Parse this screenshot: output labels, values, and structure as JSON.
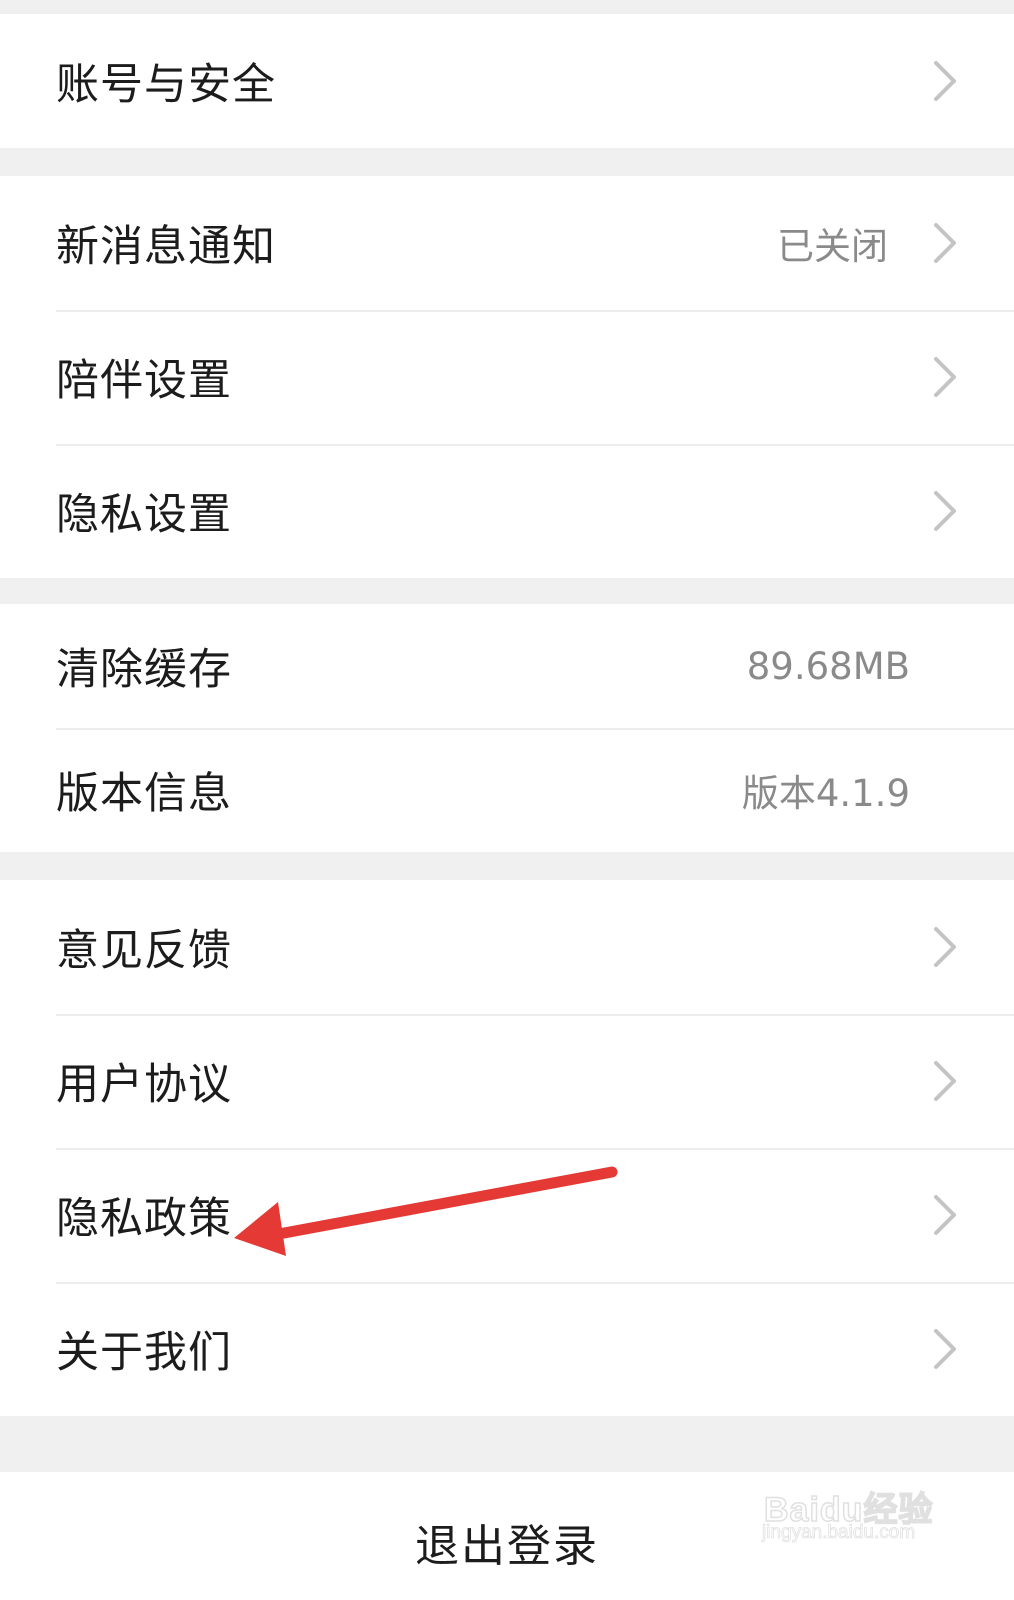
{
  "settings": {
    "groups": [
      {
        "items": [
          {
            "label": "账号与安全",
            "value": "",
            "chevron": true
          }
        ]
      },
      {
        "items": [
          {
            "label": "新消息通知",
            "value": "已关闭",
            "chevron": true
          },
          {
            "label": "陪伴设置",
            "value": "",
            "chevron": true
          },
          {
            "label": "隐私设置",
            "value": "",
            "chevron": true
          }
        ]
      },
      {
        "items": [
          {
            "label": "清除缓存",
            "value": "89.68MB",
            "chevron": false
          },
          {
            "label": "版本信息",
            "value": "版本4.1.9",
            "chevron": false
          }
        ]
      },
      {
        "items": [
          {
            "label": "意见反馈",
            "value": "",
            "chevron": true
          },
          {
            "label": "用户协议",
            "value": "",
            "chevron": true
          },
          {
            "label": "隐私政策",
            "value": "",
            "chevron": true
          },
          {
            "label": "关于我们",
            "value": "",
            "chevron": true
          }
        ]
      }
    ],
    "logout_label": "退出登录"
  },
  "annotation": {
    "arrow_color": "#e53935",
    "arrow_target": "隐私政策"
  },
  "watermark": {
    "brand": "Baidu经验",
    "url": "jingyan.baidu.com"
  },
  "icons": {
    "chevron": "chevron-right-icon"
  }
}
